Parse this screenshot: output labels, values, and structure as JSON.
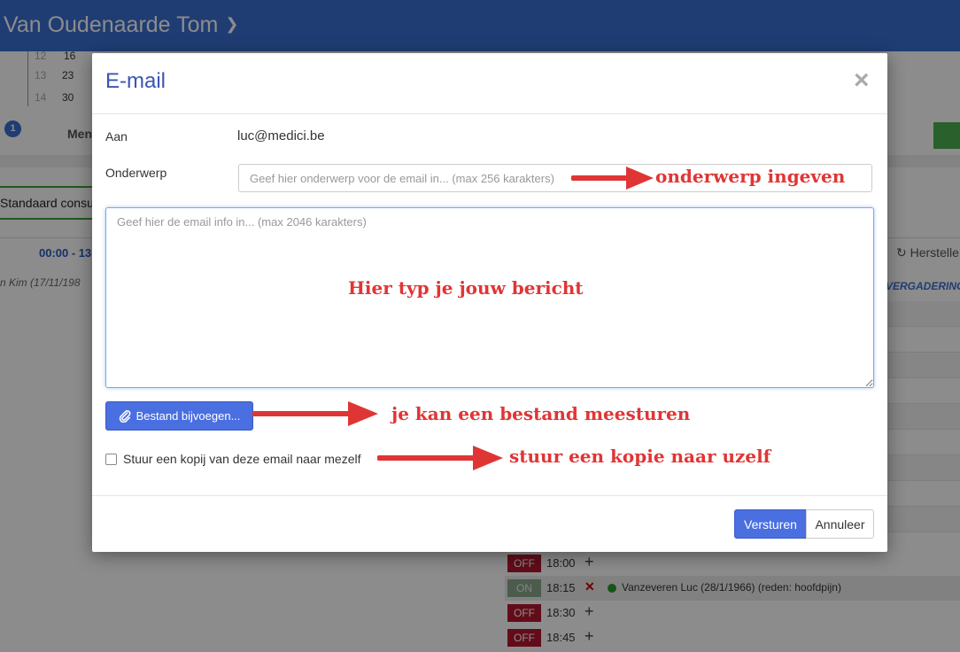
{
  "background": {
    "user_name": "Van Oudenaarde Tom",
    "calendar": {
      "rows": [
        {
          "week": "12",
          "day": "16"
        },
        {
          "week": "13",
          "day": "23"
        },
        {
          "week": "14",
          "day": "30"
        }
      ],
      "first_col_day": "23"
    },
    "badge_count": "1",
    "menu_label": "Men",
    "consult_label": "Standaard consu",
    "time_range": "00:00 - 13",
    "patient_partial": "n Kim (17/11/198",
    "reset_label": "Herstelle",
    "meeting_label": "VERGADERING",
    "slots": [
      {
        "status": "OFF",
        "time": "18:00",
        "action": "+"
      },
      {
        "status": "ON",
        "time": "18:15",
        "action": "✕",
        "patient": "Vanzeveren Luc (28/1/1966) (reden: hoofdpijn)"
      },
      {
        "status": "OFF",
        "time": "18:30",
        "action": "+"
      },
      {
        "status": "OFF",
        "time": "18:45",
        "action": "+"
      }
    ]
  },
  "modal": {
    "title": "E-mail",
    "close_symbol": "×",
    "to_label": "Aan",
    "to_value": "luc@medici.be",
    "subject_label": "Onderwerp",
    "subject_placeholder": "Geef hier onderwerp voor de email in... (max 256 karakters)",
    "body_placeholder": "Geef hier de email info in... (max 2046 karakters)",
    "attach_label": "Bestand bijvoegen...",
    "copy_label": "Stuur een kopij van deze email naar mezelf",
    "copy_checked": false,
    "send_label": "Versturen",
    "cancel_label": "Annuleer"
  },
  "annotations": {
    "subject": "onderwerp ingeven",
    "body": "Hier  typ je jouw bericht",
    "attach": "je kan een bestand meesturen",
    "copy": "stuur een kopie naar uzelf",
    "color": "#e03535"
  },
  "colors": {
    "primary": "#4a6fe0",
    "header": "#3a6fd1",
    "off": "#b5172e",
    "on": "#8aa88a"
  }
}
